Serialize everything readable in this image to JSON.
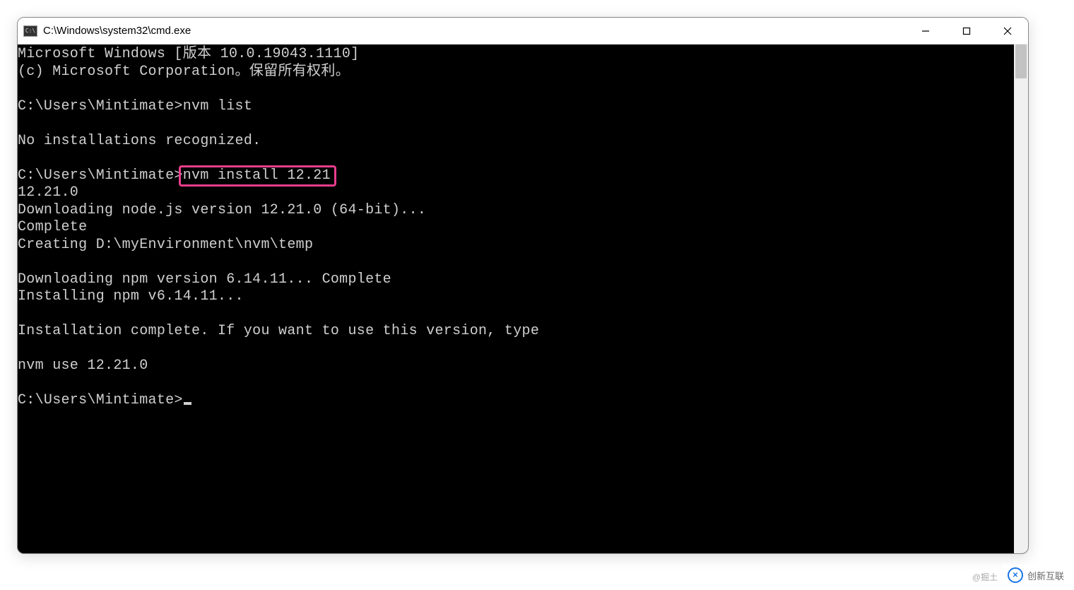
{
  "window": {
    "title": "C:\\Windows\\system32\\cmd.exe",
    "icon_label": "cmd-icon"
  },
  "terminal": {
    "lines": [
      "Microsoft Windows [版本 10.0.19043.1110]",
      "(c) Microsoft Corporation。保留所有权利。",
      "",
      "C:\\Users\\Mintimate>nvm list",
      "",
      "No installations recognized.",
      ""
    ],
    "highlight_line_prefix": "C:\\Users\\Mintimate>",
    "highlight_command": "nvm install 12.21",
    "after_highlight": [
      "12.21.0",
      "Downloading node.js version 12.21.0 (64-bit)...",
      "Complete",
      "Creating D:\\myEnvironment\\nvm\\temp",
      "",
      "Downloading npm version 6.14.11... Complete",
      "Installing npm v6.14.11...",
      "",
      "Installation complete. If you want to use this version, type",
      "",
      "nvm use 12.21.0",
      ""
    ],
    "final_prompt": "C:\\Users\\Mintimate>"
  },
  "watermark": {
    "prefix": "@掘土",
    "brand": "创新互联"
  }
}
